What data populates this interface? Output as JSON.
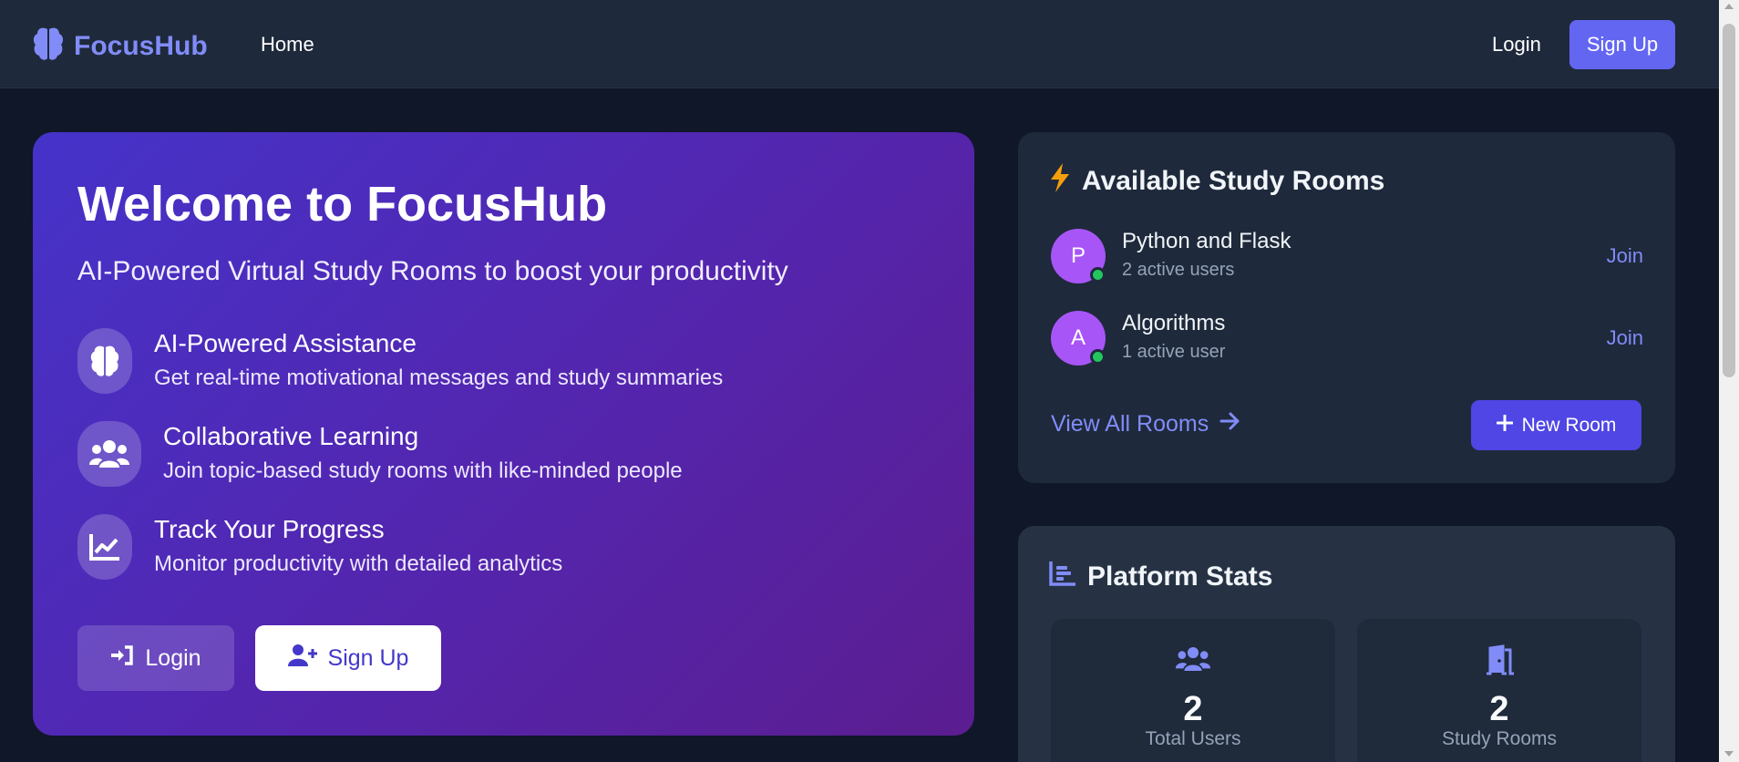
{
  "navbar": {
    "brand": "FocusHub",
    "home_label": "Home",
    "login_label": "Login",
    "signup_label": "Sign Up"
  },
  "hero": {
    "title": "Welcome to FocusHub",
    "subtitle": "AI-Powered Virtual Study Rooms to boost your productivity",
    "features": [
      {
        "icon": "brain-icon",
        "title": "AI-Powered Assistance",
        "desc": "Get real-time motivational messages and study summaries"
      },
      {
        "icon": "users-icon",
        "title": "Collaborative Learning",
        "desc": "Join topic-based study rooms with like-minded people"
      },
      {
        "icon": "chart-line-icon",
        "title": "Track Your Progress",
        "desc": "Monitor productivity with detailed analytics"
      }
    ],
    "login_label": "Login",
    "signup_label": "Sign Up"
  },
  "rooms": {
    "title": "Available Study Rooms",
    "items": [
      {
        "initial": "P",
        "name": "Python and Flask",
        "users": "2 active users",
        "join_label": "Join"
      },
      {
        "initial": "A",
        "name": "Algorithms",
        "users": "1 active user",
        "join_label": "Join"
      }
    ],
    "view_all_label": "View All Rooms",
    "new_room_label": "New Room"
  },
  "stats": {
    "title": "Platform Stats",
    "items": [
      {
        "icon": "users-icon",
        "value": "2",
        "label": "Total Users"
      },
      {
        "icon": "door-open-icon",
        "value": "2",
        "label": "Study Rooms"
      }
    ]
  },
  "colors": {
    "background": "#0f1729",
    "navbar": "#1e293b",
    "accent": "#6366f1",
    "accent_text": "#818cf8",
    "hero_gradient_start": "#4533c9",
    "hero_gradient_end": "#5b1d90",
    "avatar": "#a855f7",
    "online": "#22c55e",
    "bolt": "#f59e0b"
  }
}
